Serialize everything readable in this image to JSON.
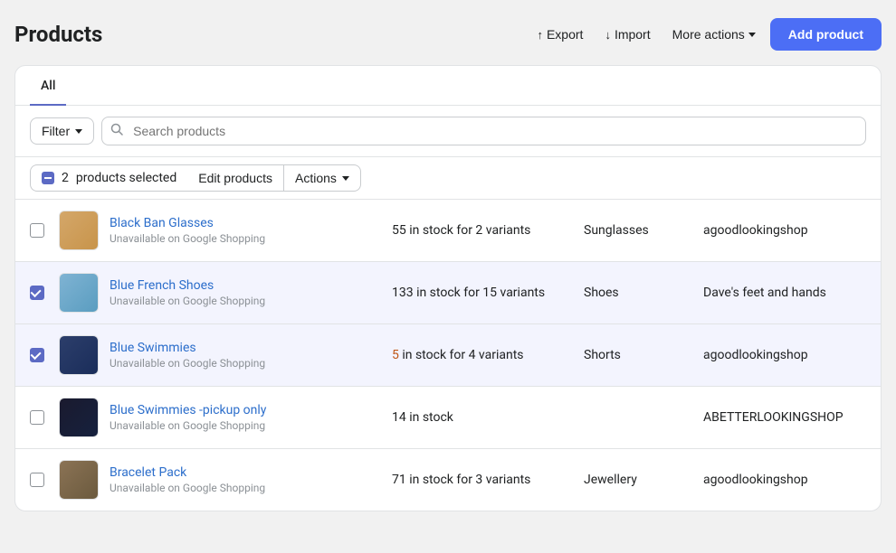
{
  "page": {
    "title": "Products",
    "add_product_label": "Add product"
  },
  "header_actions": {
    "export_label": "Export",
    "import_label": "Import",
    "more_actions_label": "More actions"
  },
  "tabs": [
    {
      "label": "All",
      "active": true
    }
  ],
  "toolbar": {
    "filter_label": "Filter",
    "search_placeholder": "Search products"
  },
  "selection_bar": {
    "count": "2",
    "products_selected_label": "products selected",
    "edit_products_label": "Edit products",
    "actions_label": "Actions"
  },
  "products": [
    {
      "id": 1,
      "name": "Black Ban Glasses",
      "sub": "Unavailable on Google Shopping",
      "stock": "55 in stock for 2 variants",
      "stock_warn": false,
      "category": "Sunglasses",
      "vendor": "agoodlookingshop",
      "selected": false,
      "thumb_type": "glasses"
    },
    {
      "id": 2,
      "name": "Blue French Shoes",
      "sub": "Unavailable on Google Shopping",
      "stock": "133 in stock for 15 variants",
      "stock_warn": false,
      "category": "Shoes",
      "vendor": "Dave's feet and hands",
      "selected": true,
      "thumb_type": "shoes"
    },
    {
      "id": 3,
      "name": "Blue Swimmies",
      "sub": "Unavailable on Google Shopping",
      "stock_prefix": "5",
      "stock_suffix": " in stock for 4 variants",
      "stock_warn": true,
      "category": "Shorts",
      "vendor": "agoodlookingshop",
      "selected": true,
      "thumb_type": "swimmies"
    },
    {
      "id": 4,
      "name": "Blue Swimmies -pickup only",
      "sub": "Unavailable on Google Shopping",
      "stock": "14 in stock",
      "stock_warn": false,
      "category": "",
      "vendor": "ABETTERLOOKINGSHOP",
      "selected": false,
      "thumb_type": "swimmies2"
    },
    {
      "id": 5,
      "name": "Bracelet Pack",
      "sub": "Unavailable on Google Shopping",
      "stock": "71 in stock for 3 variants",
      "stock_warn": false,
      "category": "Jewellery",
      "vendor": "agoodlookingshop",
      "selected": false,
      "thumb_type": "bracelet"
    }
  ]
}
